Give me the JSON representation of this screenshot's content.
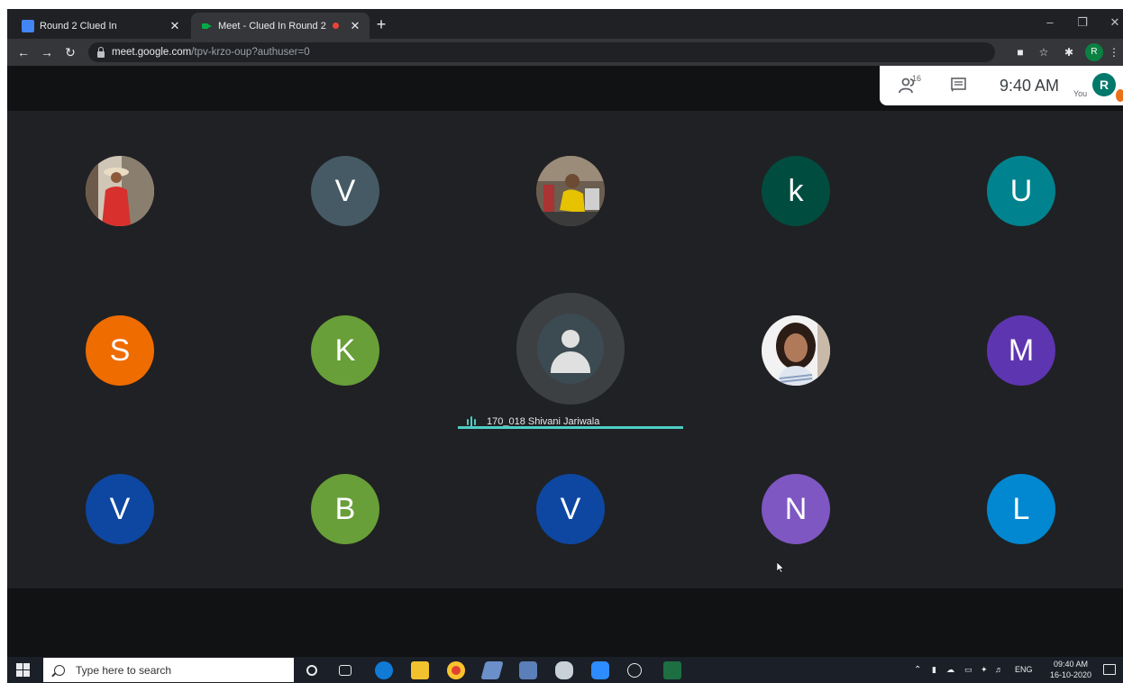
{
  "browser": {
    "tabs": [
      {
        "title": "Round 2 Clued In",
        "icon": "google-doc-icon"
      },
      {
        "title": "Meet - Clued In Round 2",
        "icon": "google-meet-icon",
        "recording": true
      }
    ],
    "new_tab": "+",
    "url_host": "meet.google.com",
    "url_path": "/tpv-krzo-oup?authuser=0",
    "profile_initial": "R"
  },
  "meet": {
    "participant_count": "16",
    "time": "9:40 AM",
    "you_label": "You",
    "you_initial": "R",
    "accent": "#4ecdc4",
    "participants": [
      {
        "initial": "",
        "photo": true,
        "tone": "#c0504d"
      },
      {
        "initial": "V",
        "color": "#455a64"
      },
      {
        "initial": "",
        "photo": true,
        "tone": "#b8a46b"
      },
      {
        "initial": "k",
        "color": "#004d40"
      },
      {
        "initial": "U",
        "color": "#00838f"
      },
      {
        "initial": "S",
        "color": "#ef6c00"
      },
      {
        "initial": "K",
        "color": "#689f38"
      },
      {
        "initial": "",
        "photo": true,
        "tone": "#a1887f"
      },
      {
        "initial": "M",
        "color": "#5e35b1"
      },
      {
        "initial": "V",
        "color": "#0d47a1"
      },
      {
        "initial": "B",
        "color": "#689f38"
      },
      {
        "initial": "V",
        "color": "#0d47a1"
      },
      {
        "initial": "N",
        "color": "#7e57c2"
      },
      {
        "initial": "L",
        "color": "#0288d1"
      }
    ],
    "active_speaker": "170_018 Shivani Jariwala"
  },
  "taskbar": {
    "search_placeholder": "Type here to search",
    "language": "ENG",
    "time": "09:40 AM",
    "date": "16-10-2020"
  }
}
